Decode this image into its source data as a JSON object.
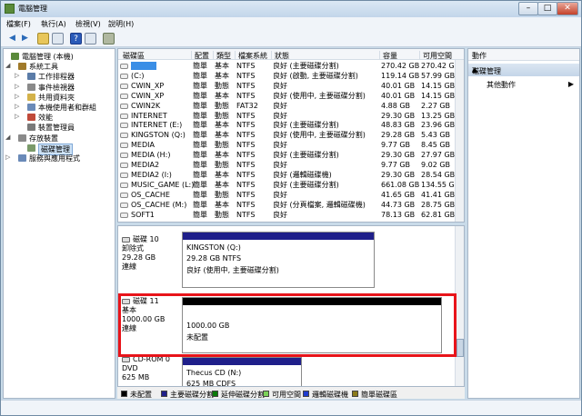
{
  "window": {
    "title": "電腦管理",
    "min": "–",
    "max": "□",
    "close": "✕"
  },
  "menu": [
    "檔案(F)",
    "執行(A)",
    "檢視(V)",
    "說明(H)"
  ],
  "toolbar": {
    "icons": [
      "back-arrow-icon",
      "forward-arrow-icon",
      "up-folder-icon",
      "show-tree-icon",
      "help-icon",
      "properties-icon",
      "settings-icon"
    ]
  },
  "tree": [
    {
      "label": "電腦管理 (本機)",
      "icon": "computer-icon",
      "color": "#5a8a3a"
    },
    {
      "label": "系統工具",
      "icon": "tools-icon",
      "color": "#a07a2a",
      "arrow": "◢"
    },
    {
      "label": "工作排程器",
      "icon": "scheduler-icon",
      "color": "#5b7ca8",
      "arrow": "▷"
    },
    {
      "label": "事件檢視器",
      "icon": "event-viewer-icon",
      "color": "#8a8a8a",
      "arrow": "▷"
    },
    {
      "label": "共用資料夾",
      "icon": "shared-folder-icon",
      "color": "#d4b24a",
      "arrow": "▷"
    },
    {
      "label": "本機使用者和群組",
      "icon": "users-icon",
      "color": "#6a8ab8",
      "arrow": "▷"
    },
    {
      "label": "效能",
      "icon": "performance-icon",
      "color": "#c04a3a",
      "arrow": "▷"
    },
    {
      "label": "裝置管理員",
      "icon": "device-manager-icon",
      "color": "#7a7a7a"
    },
    {
      "label": "存放裝置",
      "icon": "storage-icon",
      "color": "#8a8a8a",
      "arrow": "◢"
    },
    {
      "label": "磁碟管理",
      "icon": "disk-management-icon",
      "color": "#7a9a6a"
    },
    {
      "label": "服務與應用程式",
      "icon": "services-icon",
      "color": "#6a8ab8",
      "arrow": "▷"
    }
  ],
  "volume_table": {
    "headers": [
      "磁碟區",
      "配置",
      "類型",
      "檔案系統",
      "狀態",
      "容量",
      "可用空間"
    ],
    "rows": [
      {
        "name": "",
        "layout": "簡單",
        "type": "基本",
        "fs": "NTFS",
        "status": "良好 (主要磁碟分割)",
        "cap": "270.42 GB",
        "free": "270.42 GB",
        "selected": true
      },
      {
        "name": "(C:)",
        "layout": "簡單",
        "type": "基本",
        "fs": "NTFS",
        "status": "良好 (啟動, 主要磁碟分割)",
        "cap": "119.14 GB",
        "free": "57.99 GB"
      },
      {
        "name": "CWIN_XP",
        "layout": "簡單",
        "type": "動態",
        "fs": "NTFS",
        "status": "良好",
        "cap": "40.01 GB",
        "free": "14.15 GB"
      },
      {
        "name": "CWIN_XP",
        "layout": "簡單",
        "type": "基本",
        "fs": "NTFS",
        "status": "良好 (使用中, 主要磁碟分割)",
        "cap": "40.01 GB",
        "free": "14.15 GB"
      },
      {
        "name": "CWIN2K",
        "layout": "簡單",
        "type": "動態",
        "fs": "FAT32",
        "status": "良好",
        "cap": "4.88 GB",
        "free": "2.27 GB"
      },
      {
        "name": "INTERNET",
        "layout": "簡單",
        "type": "動態",
        "fs": "NTFS",
        "status": "良好",
        "cap": "29.30 GB",
        "free": "13.25 GB"
      },
      {
        "name": "INTERNET (E:)",
        "layout": "簡單",
        "type": "基本",
        "fs": "NTFS",
        "status": "良好 (主要磁碟分割)",
        "cap": "48.83 GB",
        "free": "23.96 GB"
      },
      {
        "name": "KINGSTON (Q:)",
        "layout": "簡單",
        "type": "基本",
        "fs": "NTFS",
        "status": "良好 (使用中, 主要磁碟分割)",
        "cap": "29.28 GB",
        "free": "5.43 GB"
      },
      {
        "name": "MEDIA",
        "layout": "簡單",
        "type": "動態",
        "fs": "NTFS",
        "status": "良好",
        "cap": "9.77 GB",
        "free": "8.45 GB"
      },
      {
        "name": "MEDIA (H:)",
        "layout": "簡單",
        "type": "基本",
        "fs": "NTFS",
        "status": "良好 (主要磁碟分割)",
        "cap": "29.30 GB",
        "free": "27.97 GB"
      },
      {
        "name": "MEDIA2",
        "layout": "簡單",
        "type": "動態",
        "fs": "NTFS",
        "status": "良好",
        "cap": "9.77 GB",
        "free": "9.02 GB"
      },
      {
        "name": "MEDIA2 (I:)",
        "layout": "簡單",
        "type": "基本",
        "fs": "NTFS",
        "status": "良好 (邏輯磁碟機)",
        "cap": "29.30 GB",
        "free": "28.54 GB"
      },
      {
        "name": "MUSIC_GAME (L:)",
        "layout": "簡單",
        "type": "基本",
        "fs": "NTFS",
        "status": "良好 (主要磁碟分割)",
        "cap": "661.08 GB",
        "free": "134.55 GB"
      },
      {
        "name": "OS_CACHE",
        "layout": "簡單",
        "type": "動態",
        "fs": "NTFS",
        "status": "良好",
        "cap": "41.65 GB",
        "free": "41.41 GB"
      },
      {
        "name": "OS_CACHE (M:)",
        "layout": "簡單",
        "type": "基本",
        "fs": "NTFS",
        "status": "良好 (分頁檔案, 邏輯磁碟機)",
        "cap": "44.73 GB",
        "free": "28.75 GB"
      },
      {
        "name": "SOFT1",
        "layout": "簡單",
        "type": "動態",
        "fs": "NTFS",
        "status": "良好",
        "cap": "78.13 GB",
        "free": "62.81 GB"
      }
    ]
  },
  "disks": [
    {
      "name": "磁碟 10",
      "icon": "removable-disk-icon",
      "l1": "卸除式",
      "l2": "29.28 GB",
      "l3": "連線",
      "part_title": "KINGSTON (Q:)",
      "part_l1": "29.28 GB NTFS",
      "part_l2": "良好 (使用中, 主要磁碟分割)",
      "bar": "#1f1f8a"
    },
    {
      "name": "磁碟 11",
      "icon": "hard-disk-icon",
      "l1": "基本",
      "l2": "1000.00 GB",
      "l3": "連線",
      "part_title": "",
      "part_l1": "1000.00 GB",
      "part_l2": "未配置",
      "bar": "#000000"
    },
    {
      "name": "CD-ROM 0",
      "icon": "cdrom-icon",
      "l1": "DVD",
      "l2": "625 MB",
      "l3": "",
      "part_title": "Thecus CD  (N:)",
      "part_l1": "625 MB CDFS",
      "part_l2": "",
      "bar": "#1f1f8a"
    }
  ],
  "legend": [
    {
      "label": "未配置",
      "color": "#000000"
    },
    {
      "label": "主要磁碟分割",
      "color": "#1f1f8a"
    },
    {
      "label": "延伸磁碟分割",
      "color": "#0a7a0a"
    },
    {
      "label": "可用空間",
      "color": "#7bd15a"
    },
    {
      "label": "邏輯磁碟機",
      "color": "#1f3ccf"
    },
    {
      "label": "簡單磁碟區",
      "color": "#8a7a1a"
    }
  ],
  "actions": {
    "header": "動作",
    "section": "磁碟管理",
    "up": "▲",
    "more": "其他動作",
    "more_arrow": "▶"
  }
}
